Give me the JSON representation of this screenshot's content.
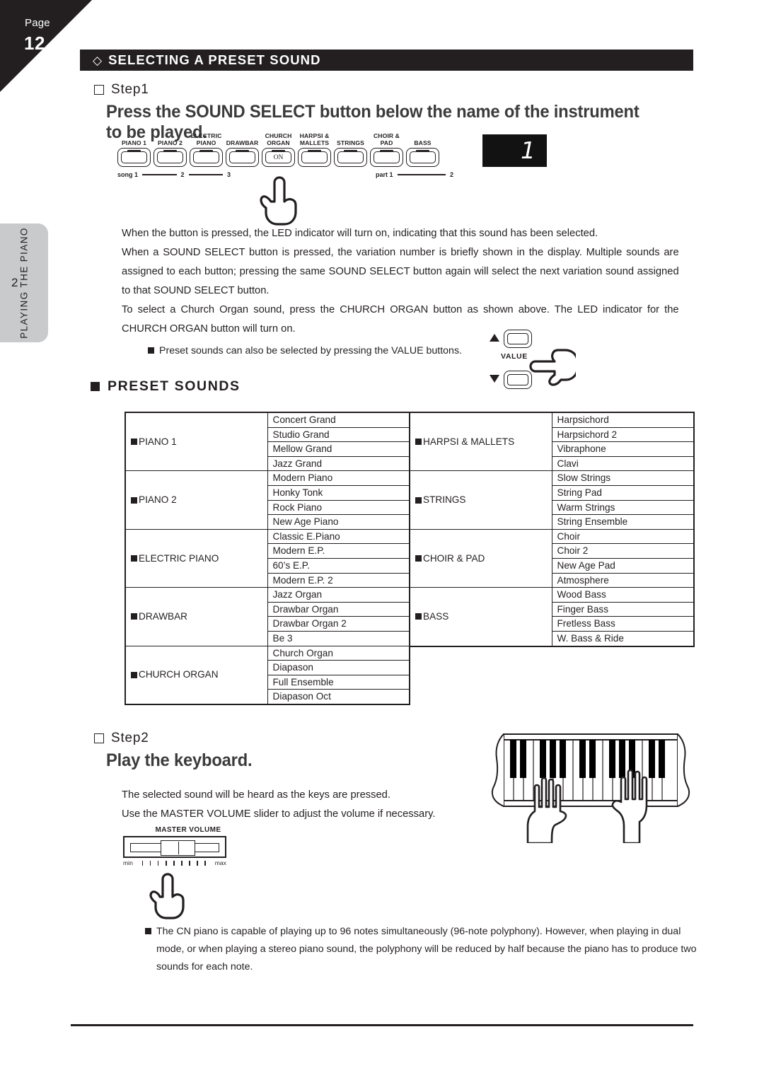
{
  "page": {
    "page_word": "Page",
    "page_number": "12",
    "chapter_number": "2",
    "chapter_title": "PLAYING THE PIANO"
  },
  "section": {
    "diamond_glyph": "◇",
    "title": "SELECTING A PRESET SOUND"
  },
  "step1": {
    "label": "Step1",
    "instruction": "Press the SOUND SELECT button below the name of the instrument to be played."
  },
  "panel": {
    "buttons": [
      {
        "caption": "PIANO 1",
        "caption_line2": "",
        "state": ""
      },
      {
        "caption": "PIANO 2",
        "caption_line2": "",
        "state": ""
      },
      {
        "caption": "ELECTRIC",
        "caption_line2": "PIANO",
        "state": ""
      },
      {
        "caption": "DRAWBAR",
        "caption_line2": "",
        "state": ""
      },
      {
        "caption": "CHURCH",
        "caption_line2": "ORGAN",
        "state": "ON"
      },
      {
        "caption": "HARPSI &",
        "caption_line2": "MALLETS",
        "state": ""
      },
      {
        "caption": "STRINGS",
        "caption_line2": "",
        "state": ""
      },
      {
        "caption": "CHOIR &",
        "caption_line2": "PAD",
        "state": ""
      },
      {
        "caption": "BASS",
        "caption_line2": "",
        "state": ""
      }
    ],
    "song_label": "song 1",
    "song_2": "2",
    "song_3": "3",
    "part_label": "part 1",
    "part_2": "2",
    "display_value": "1"
  },
  "body": {
    "para1": "When the button is pressed, the LED indicator will turn on, indicating that this sound has been selected.",
    "para2": "When a SOUND SELECT button is pressed, the variation number is briefly shown in the display. Multiple sounds are assigned to each button; pressing the same SOUND SELECT button again will select the next variation sound assigned to that SOUND SELECT button.",
    "para3": "To select a Church Organ sound, press the CHURCH ORGAN button as shown above. The LED indicator for the CHURCH ORGAN button will turn on."
  },
  "note1": {
    "text": "Preset sounds can also be selected by pressing the VALUE buttons."
  },
  "value_buttons": {
    "label": "VALUE",
    "up_arrow": "▲",
    "down_arrow": "▼"
  },
  "preset_sounds": {
    "heading": "PRESET SOUNDS",
    "left": [
      {
        "category": "PIANO 1",
        "sounds": [
          "Concert Grand",
          "Studio Grand",
          "Mellow Grand",
          "Jazz Grand"
        ]
      },
      {
        "category": "PIANO 2",
        "sounds": [
          "Modern Piano",
          "Honky Tonk",
          "Rock Piano",
          "New Age Piano"
        ]
      },
      {
        "category": "ELECTRIC PIANO",
        "sounds": [
          "Classic E.Piano",
          "Modern E.P.",
          "60’s E.P.",
          "Modern E.P. 2"
        ]
      },
      {
        "category": "DRAWBAR",
        "sounds": [
          "Jazz Organ",
          "Drawbar Organ",
          "Drawbar Organ 2",
          "Be 3"
        ]
      },
      {
        "category": "CHURCH ORGAN",
        "sounds": [
          "Church Organ",
          "Diapason",
          "Full Ensemble",
          "Diapason Oct"
        ]
      }
    ],
    "right": [
      {
        "category": "HARPSI & MALLETS",
        "sounds": [
          "Harpsichord",
          "Harpsichord 2",
          "Vibraphone",
          "Clavi"
        ]
      },
      {
        "category": "STRINGS",
        "sounds": [
          "Slow Strings",
          "String Pad",
          "Warm Strings",
          "String Ensemble"
        ]
      },
      {
        "category": "CHOIR & PAD",
        "sounds": [
          "Choir",
          "Choir 2",
          "New Age Pad",
          "Atmosphere"
        ]
      },
      {
        "category": "BASS",
        "sounds": [
          "Wood Bass",
          "Finger Bass",
          "Fretless Bass",
          "W. Bass & Ride"
        ]
      }
    ]
  },
  "step2": {
    "label": "Step2",
    "instruction": "Play the keyboard.",
    "para1": "The selected sound will be heard as the keys are pressed.",
    "para2": "Use the MASTER VOLUME slider to adjust the volume if necessary."
  },
  "master_volume": {
    "title": "MASTER VOLUME",
    "min_label": "min",
    "max_label": "max"
  },
  "note2": {
    "text": "The CN piano is capable of playing up to 96 notes simultaneously (96-note polyphony). However, when playing in dual mode, or when playing a stereo piano sound, the polyphony will be reduced by half because the piano has to produce two sounds for each note."
  }
}
